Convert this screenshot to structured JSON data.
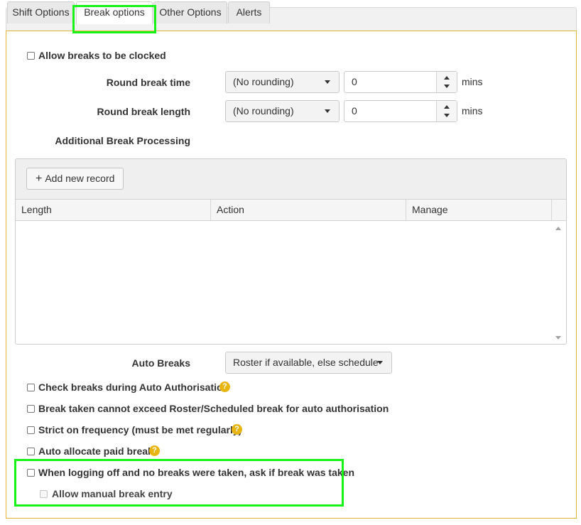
{
  "tabs": [
    {
      "label": "Shift Options",
      "active": false
    },
    {
      "label": "Break options",
      "active": true
    },
    {
      "label": "Other Options",
      "active": false
    },
    {
      "label": "Alerts",
      "active": false
    }
  ],
  "allow_breaks_clocked": {
    "label": "Allow breaks to be clocked",
    "checked": false
  },
  "round_break_time": {
    "label": "Round break time",
    "select_value": "(No rounding)",
    "value": "0",
    "unit": "mins"
  },
  "round_break_length": {
    "label": "Round break length",
    "select_value": "(No rounding)",
    "value": "0",
    "unit": "mins"
  },
  "additional_break_processing": {
    "label": "Additional Break Processing"
  },
  "grid": {
    "add_button_label": "Add new record",
    "columns": [
      "Length",
      "Action",
      "Manage"
    ],
    "rows": []
  },
  "auto_breaks": {
    "label": "Auto Breaks",
    "select_value": "Roster if available, else schedule"
  },
  "options": [
    {
      "label": "Check breaks during Auto Authorisation",
      "checked": false,
      "help": true
    },
    {
      "label": "Break taken cannot exceed Roster/Scheduled break for auto authorisation",
      "checked": false,
      "help": false
    },
    {
      "label": "Strict on frequency (must be met regularly)",
      "checked": false,
      "help": true
    },
    {
      "label": "Auto allocate paid break",
      "checked": false,
      "help": true
    },
    {
      "label": "When logging off and no breaks were taken, ask if break was taken",
      "checked": false,
      "help": false
    }
  ],
  "allow_manual_break_entry": {
    "label": "Allow manual break entry",
    "checked": false,
    "disabled": true
  },
  "help_glyph": "?",
  "colors": {
    "panel_border": "#e3b338",
    "highlight": "#16f316",
    "help_icon": "#e8b40f"
  }
}
